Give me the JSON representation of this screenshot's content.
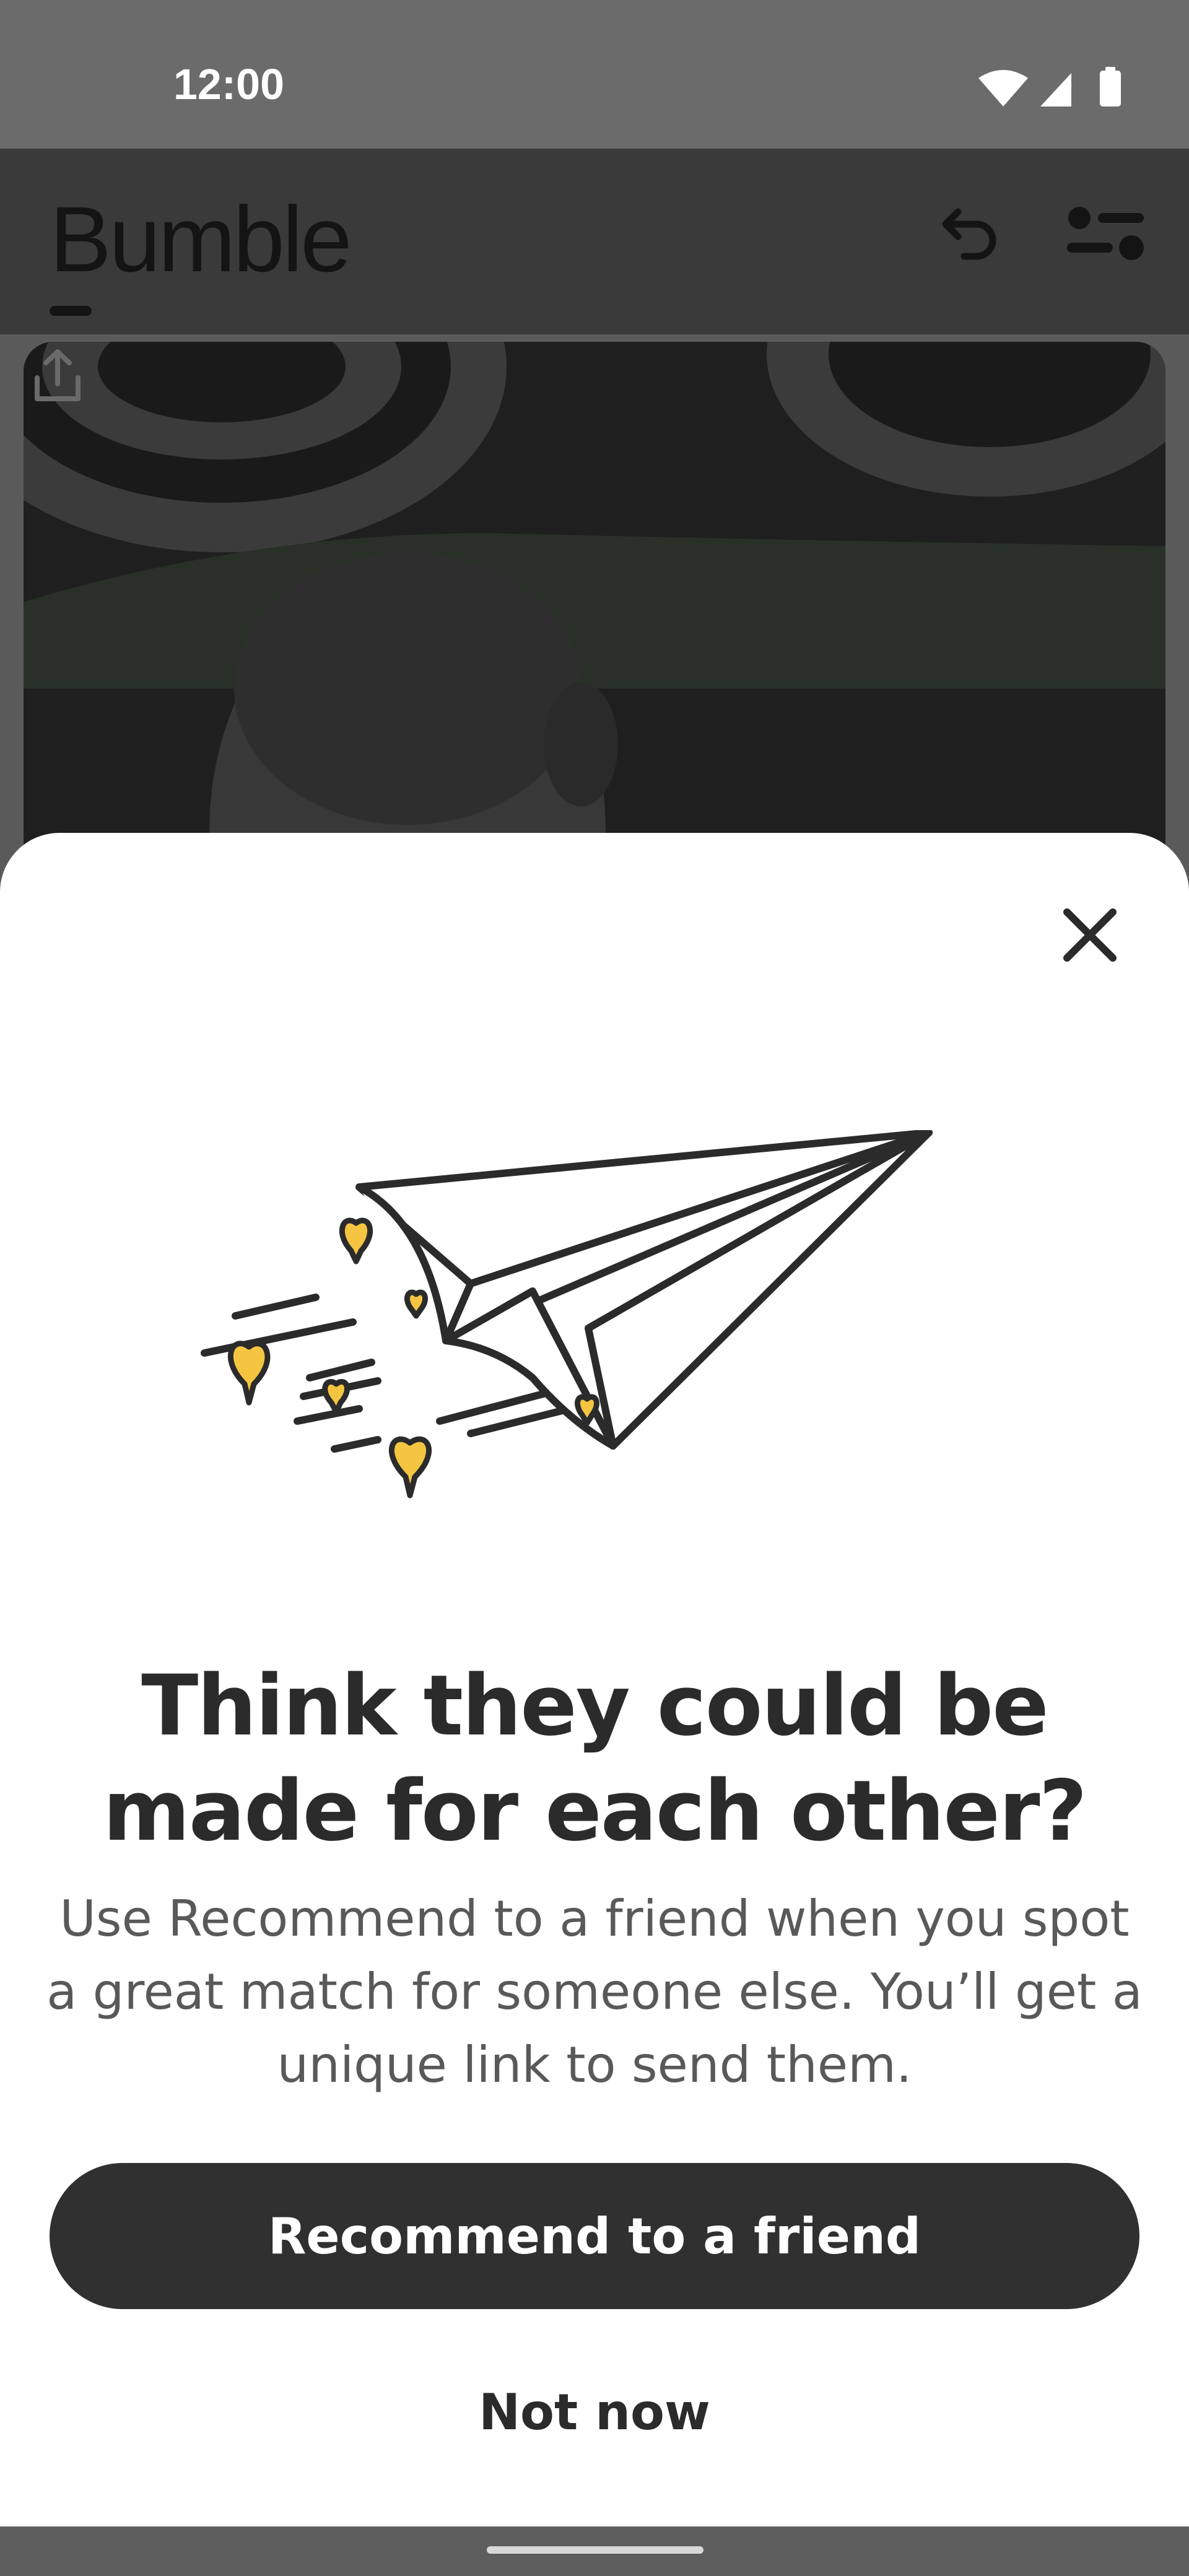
{
  "status_bar": {
    "time": "12:00",
    "icons": [
      "wifi-icon",
      "cellular-signal-icon",
      "battery-icon"
    ]
  },
  "header": {
    "app_name": "Bumble",
    "icons": [
      "undo-icon",
      "filter-icon"
    ]
  },
  "profile_card": {
    "icons": [
      "share-icon"
    ]
  },
  "sheet": {
    "close_icon": "close-icon",
    "illustration": "paper-airplane-with-hearts",
    "title": "Think they could be made for each other?",
    "description": "Use Recommend to a friend when you spot a great match for someone else. You’ll get a unique link to send them.",
    "primary_button": "Recommend to a friend",
    "secondary_button": "Not now"
  },
  "colors": {
    "scrim": "#3a3a3a",
    "sheet_background": "#ffffff",
    "primary_button": "#303030",
    "heart_accent": "#f5c542",
    "title_text": "#2b2b2b",
    "body_text": "#595959"
  }
}
